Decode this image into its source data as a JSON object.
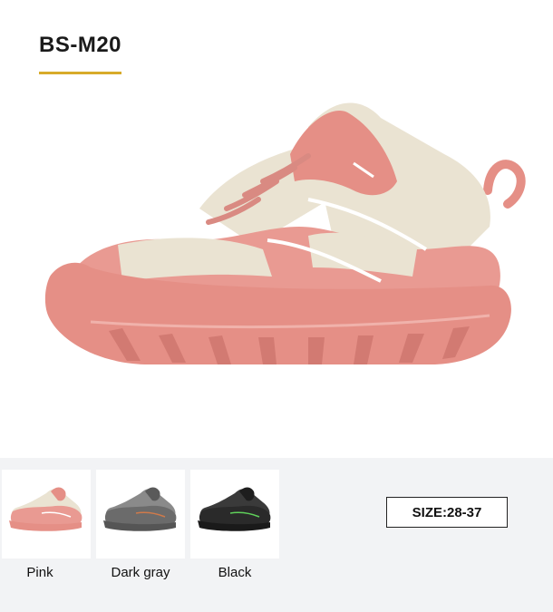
{
  "product": {
    "model": "BS-M20",
    "accent_color": "#d8ab2a"
  },
  "main_image": {
    "icon": "pink-hiking-shoe-image",
    "color": "#e99a92"
  },
  "variants": [
    {
      "label": "Pink",
      "icon": "pink-shoe-thumbnail",
      "color": "#e99a92",
      "accent": "#eae3d2"
    },
    {
      "label": "Dark gray",
      "icon": "dark-gray-shoe-thumbnail",
      "color": "#6b6b6b",
      "accent": "#d07a4a"
    },
    {
      "label": "Black",
      "icon": "black-shoe-thumbnail",
      "color": "#2a2a2a",
      "accent": "#5fd05a"
    }
  ],
  "size": {
    "text": "SIZE:28-37"
  }
}
